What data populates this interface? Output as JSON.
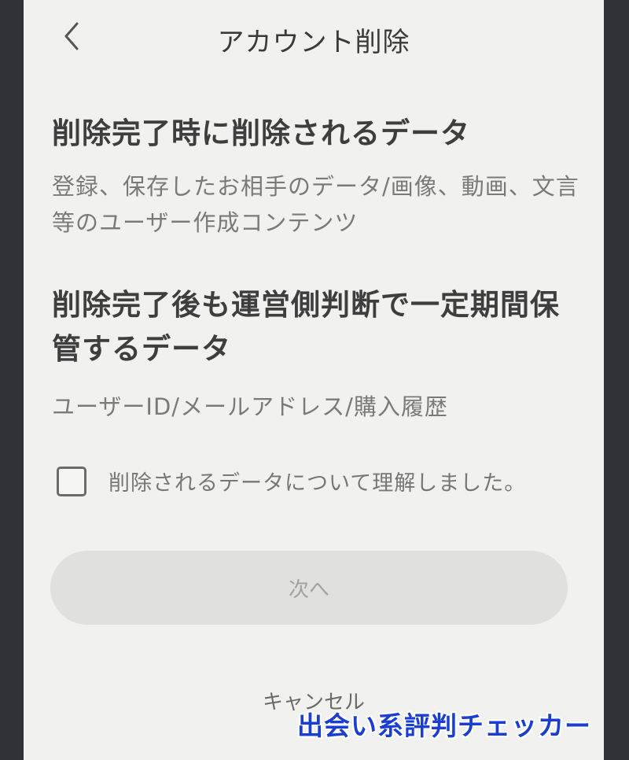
{
  "header": {
    "back_icon": "chevron-left-icon",
    "title": "アカウント削除"
  },
  "sections": [
    {
      "heading": "削除完了時に削除されるデータ",
      "body": "登録、保存したお相手のデータ/画像、動画、文言等のユーザー作成コンテンツ"
    },
    {
      "heading": "削除完了後も運営側判断で一定期間保管するデータ",
      "body": "ユーザーID/メールアドレス/購入履歴"
    }
  ],
  "confirm": {
    "checked": false,
    "label": "削除されるデータについて理解しました。"
  },
  "buttons": {
    "next_label": "次へ",
    "cancel_label": "キャンセル"
  },
  "watermark": "出会い系評判チェッカー",
  "colors": {
    "screen_background": "#f1f1ef",
    "frame": "#2f3136",
    "disabled_button": "#e0e0de",
    "watermark": "#1a3fd0"
  }
}
